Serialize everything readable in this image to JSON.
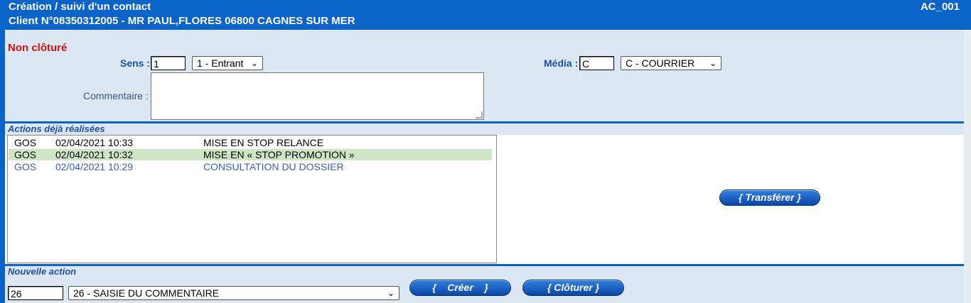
{
  "header": {
    "title": "Création / suivi d'un contact",
    "client_line": "Client N°08350312005 - MR PAUL,FLORES 06800 CAGNES SUR MER",
    "screen_code": "AC_001"
  },
  "form": {
    "status": "Non clôturé",
    "sens_label": "Sens :",
    "sens_value": "1",
    "sens_selected": "1 - Entrant",
    "media_label": "Média :",
    "media_value": "C",
    "media_selected": "C - COURRIER",
    "comment_label": "Commentaire :",
    "comment_value": ""
  },
  "actions": {
    "title": "Actions déjà réalisées",
    "rows": [
      {
        "user": "GOS",
        "datetime": "02/04/2021 10:33",
        "label": "MISE EN STOP RELANCE",
        "style": "normal"
      },
      {
        "user": "GOS",
        "datetime": "02/04/2021 10:32",
        "label": "MISE EN « STOP PROMOTION »",
        "style": "selected"
      },
      {
        "user": "GOS",
        "datetime": "02/04/2021 10:29",
        "label": "CONSULTATION DU DOSSIER",
        "style": "link"
      }
    ],
    "transfer_label": "{ Transférer }"
  },
  "new_action": {
    "title": "Nouvelle action",
    "code_value": "26",
    "selected": "26 - SAISIE DU COMMENTAIRE",
    "create_label": "{    Créer    }",
    "close_label": "{ Clôturer }"
  },
  "colors": {
    "header_bg": "#0a63c9",
    "panel_bg": "#dbe8f4",
    "selected_row": "#cde6c4",
    "link_text": "#3b5fb4",
    "status_red": "#d01010"
  }
}
